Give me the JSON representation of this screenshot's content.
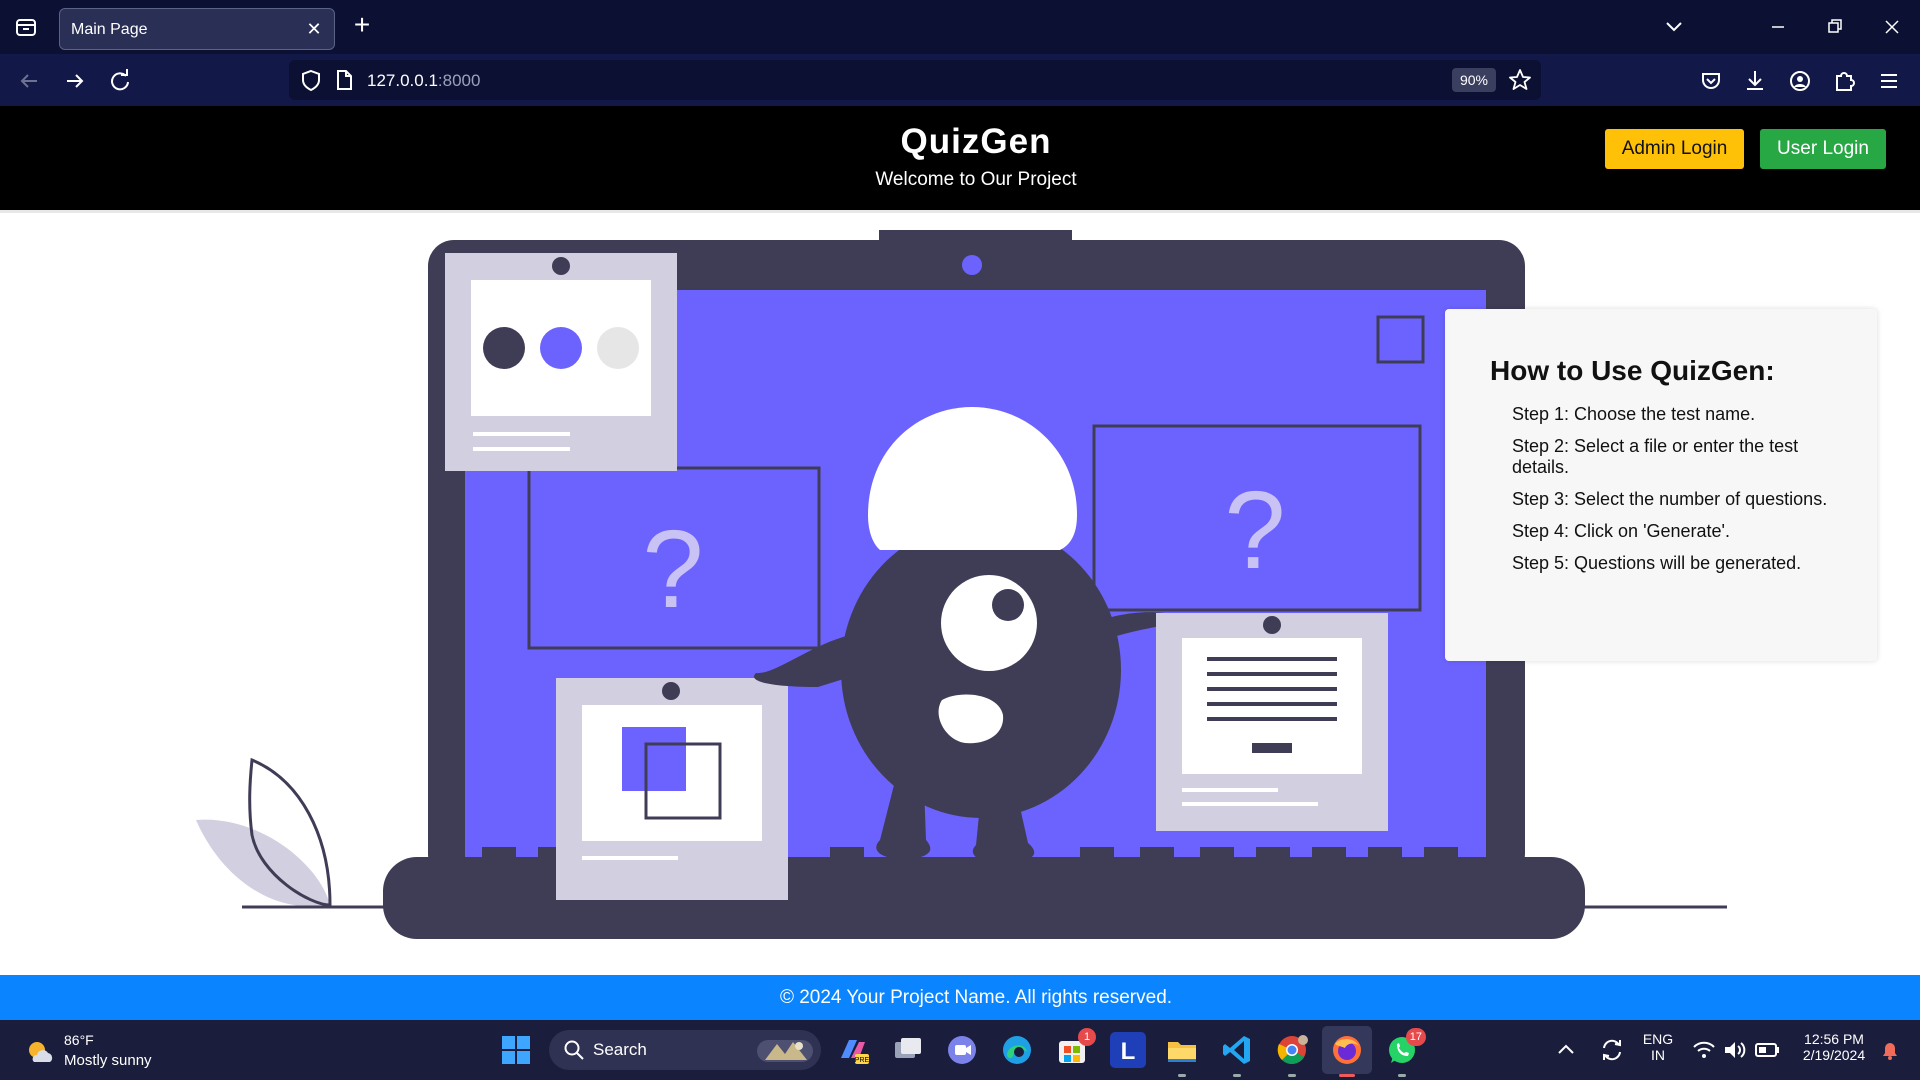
{
  "browser": {
    "tab_title": "Main Page",
    "url_host": "127.0.0.1",
    "url_port": ":8000",
    "zoom": "90%"
  },
  "site": {
    "title": "QuizGen",
    "subtitle": "Welcome to Our Project",
    "admin_login": "Admin Login",
    "user_login": "User Login"
  },
  "howto": {
    "heading": "How to Use QuizGen:",
    "steps": [
      "Step 1: Choose the test name.",
      "Step 2: Select a file or enter the test details.",
      "Step 3: Select the number of questions.",
      "Step 4: Click on 'Generate'.",
      "Step 5: Questions will be generated."
    ]
  },
  "footer": {
    "text": "© 2024 Your Project Name. All rights reserved."
  },
  "taskbar": {
    "weather_temp": "86°F",
    "weather_cond": "Mostly sunny",
    "search_label": "Search",
    "store_badge": "1",
    "whatsapp_badge": "17",
    "lang": "ENG",
    "region": "IN",
    "time": "12:56 PM",
    "date": "2/19/2024"
  },
  "colors": {
    "header_bg": "#000000",
    "admin_button": "#ffc107",
    "user_button": "#28a745",
    "footer_bg": "#0a84ff",
    "illustration_accent": "#6c63ff",
    "illustration_dark": "#3f3d56"
  }
}
